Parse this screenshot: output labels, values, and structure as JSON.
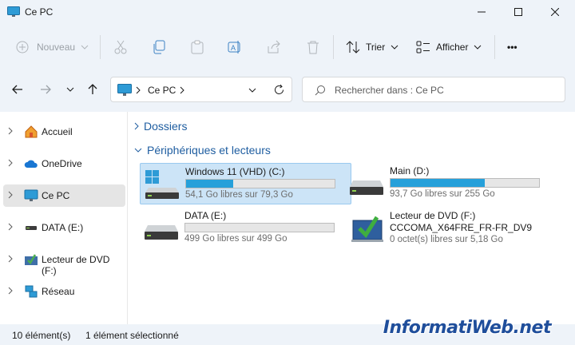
{
  "window": {
    "title": "Ce PC"
  },
  "toolbar": {
    "new_label": "Nouveau",
    "sort_label": "Trier",
    "view_label": "Afficher",
    "more_label": "•••"
  },
  "address": {
    "location": "Ce PC",
    "search_placeholder": "Rechercher dans : Ce PC"
  },
  "sidebar": {
    "items": [
      {
        "label": "Accueil",
        "icon": "home-icon"
      },
      {
        "label": "OneDrive",
        "icon": "cloud-icon"
      },
      {
        "label": "Ce PC",
        "icon": "monitor-icon",
        "selected": true
      },
      {
        "label": "DATA (E:)",
        "icon": "drive-icon"
      },
      {
        "label": "Lecteur de DVD (F:)",
        "icon": "dvd-icon"
      },
      {
        "label": "Réseau",
        "icon": "network-icon"
      }
    ]
  },
  "main": {
    "sections": [
      {
        "label": "Dossiers",
        "expanded": false
      },
      {
        "label": "Périphériques et lecteurs",
        "expanded": true
      }
    ],
    "drives": [
      {
        "name": "Windows 11 (VHD) (C:)",
        "free": "54,1 Go libres sur 79,3 Go",
        "used_fraction": 0.318,
        "selected": true
      },
      {
        "name": "Main (D:)",
        "free": "93,7 Go libres sur 255 Go",
        "used_fraction": 0.633
      },
      {
        "name": "DATA (E:)",
        "free": "499 Go libres sur 499 Go",
        "used_fraction": 0.0
      },
      {
        "name": "Lecteur de DVD (F:)",
        "line2": "CCCOMA_X64FRE_FR-FR_DV9",
        "free": "0 octet(s) libres sur 5,18 Go"
      }
    ]
  },
  "status": {
    "count": "10 élément(s)",
    "selection": "1 élément sélectionné"
  },
  "watermark": "InformatiWeb.net",
  "colors": {
    "accent": "#26a0da",
    "section": "#1e5da0",
    "selected": "#cce4f7"
  }
}
